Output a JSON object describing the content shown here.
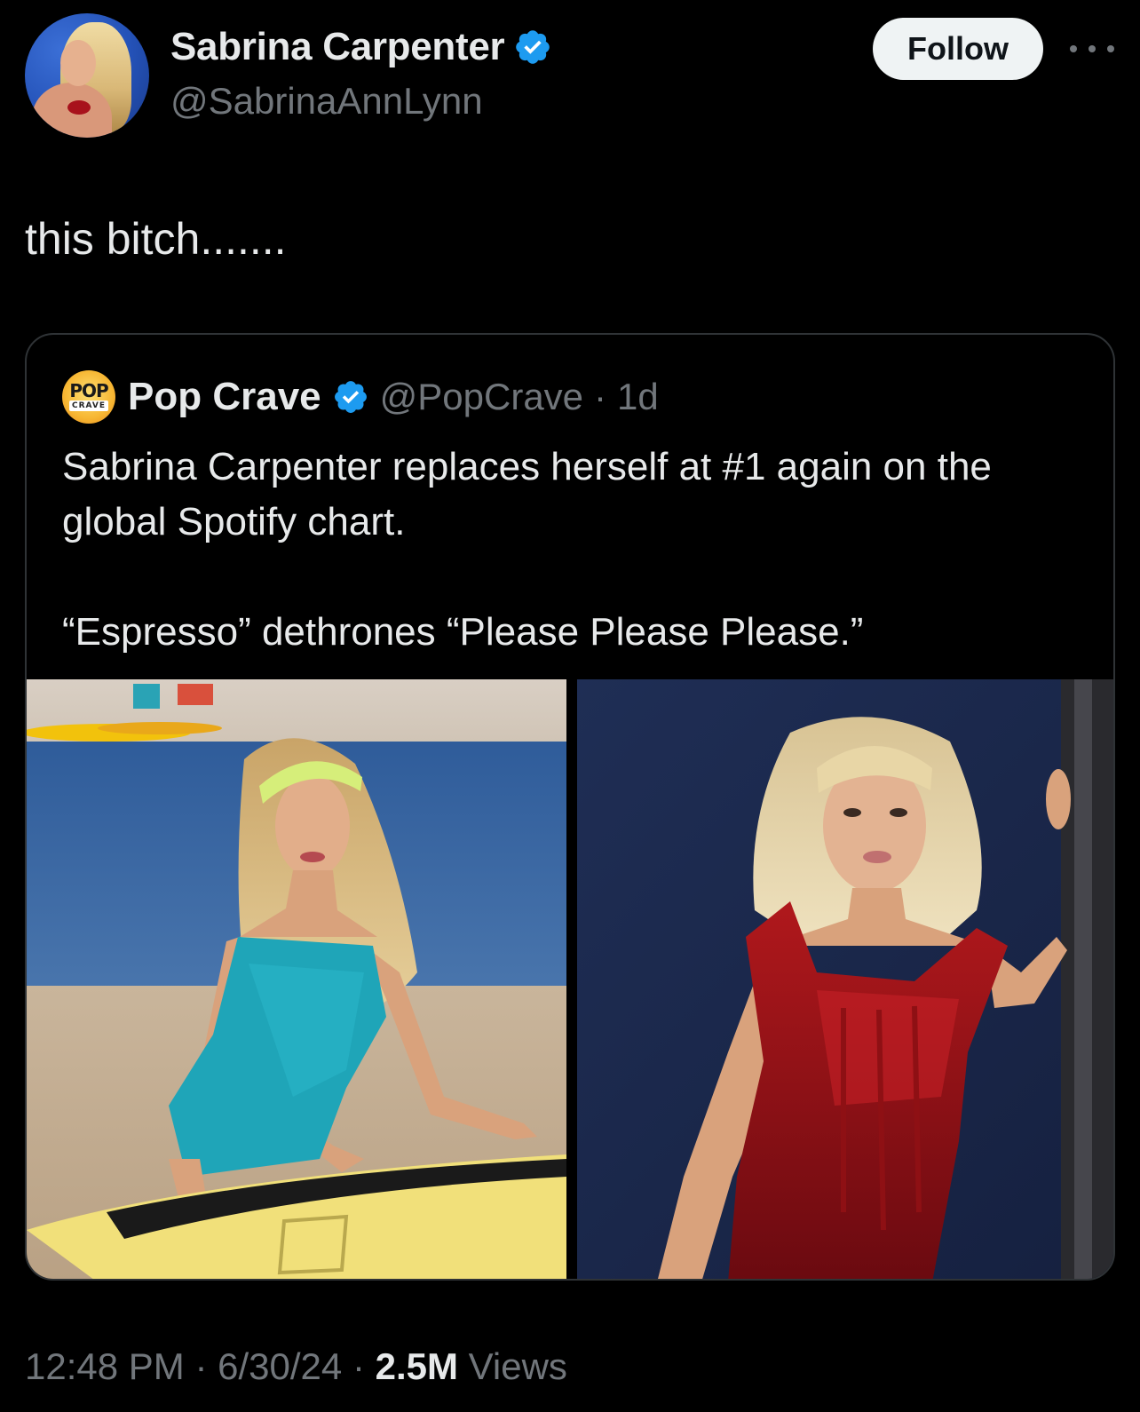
{
  "author": {
    "display_name": "Sabrina Carpenter",
    "handle": "@SabrinaAnnLynn",
    "verified": true
  },
  "actions": {
    "follow_label": "Follow",
    "more_icon": "more-horizontal-icon"
  },
  "tweet": {
    "text": "this bitch......."
  },
  "quote": {
    "author_name": "Pop Crave",
    "handle": "@PopCrave",
    "separator": "·",
    "time_ago": "1d",
    "verified": true,
    "logo_text_top": "POP",
    "logo_text_bottom": "CRAVE",
    "text_line1": "Sabrina Carpenter replaces herself at #1 again on the global Spotify chart.",
    "text_line2": "“Espresso” dethrones “Please Please Please.”",
    "media_count": 2
  },
  "footer": {
    "time": "12:48 PM",
    "separator": "·",
    "date": "6/30/24",
    "views_count": "2.5M",
    "views_label": "Views"
  },
  "colors": {
    "background": "#000000",
    "text_primary": "#e7e9ea",
    "text_secondary": "#71767b",
    "verified_blue": "#1d9bf0",
    "border": "#2f3336",
    "follow_bg": "#eff3f4"
  }
}
